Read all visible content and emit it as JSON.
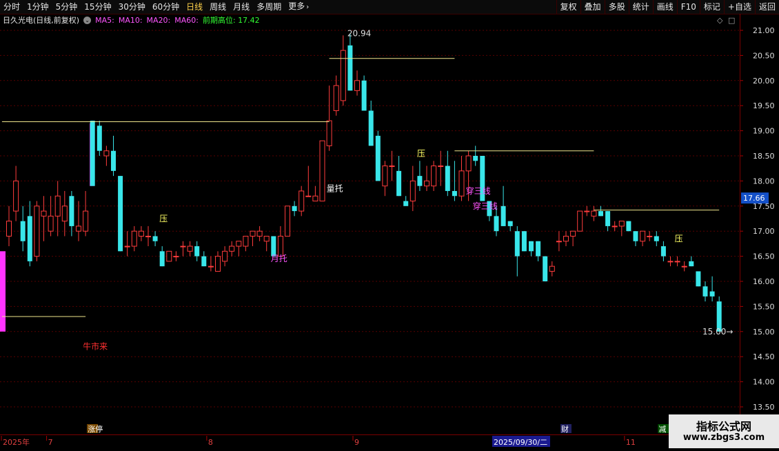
{
  "toolbar": {
    "tabs": [
      {
        "label": "分时",
        "active": false
      },
      {
        "label": "1分钟",
        "active": false
      },
      {
        "label": "5分钟",
        "active": false
      },
      {
        "label": "15分钟",
        "active": false
      },
      {
        "label": "30分钟",
        "active": false
      },
      {
        "label": "60分钟",
        "active": false
      },
      {
        "label": "日线",
        "active": true
      },
      {
        "label": "周线",
        "active": false
      },
      {
        "label": "月线",
        "active": false
      },
      {
        "label": "多周期",
        "active": false
      },
      {
        "label": "更多",
        "active": false
      }
    ],
    "more_chevron": "›",
    "right_buttons": [
      "复权",
      "叠加",
      "多股",
      "统计",
      "画线",
      "F10",
      "标记",
      "+自选",
      "返回"
    ]
  },
  "infobar": {
    "stock": "日久光电(日线,前复权)",
    "toggle_glyph": "⌄",
    "ma5": "MA5:",
    "ma10": "MA10:",
    "ma20": "MA20:",
    "ma60": "MA60:",
    "prev_high": "前期高位: 17.42",
    "icon_diamond": "◇",
    "icon_restore": "□"
  },
  "colors": {
    "up": "#ff3c3c",
    "down": "#39e6ea",
    "signal": "#ff33ff",
    "hline": "#f0e68c",
    "grid": "#5a0000",
    "ma5": "#ff55ff",
    "ma_other": "#ff55ff",
    "prev_high": "#33ff33"
  },
  "chart_data": {
    "type": "candlestick",
    "ylim": [
      13.25,
      21.15
    ],
    "y_ticks": [
      "21.00",
      "20.50",
      "20.00",
      "19.50",
      "19.00",
      "18.50",
      "18.00",
      "17.50",
      "17.00",
      "16.50",
      "16.00",
      "15.50",
      "15.00",
      "14.50",
      "14.00",
      "13.50"
    ],
    "last_price": "17.66",
    "candles": [
      {
        "o": 16.9,
        "h": 17.5,
        "l": 16.7,
        "c": 17.2
      },
      {
        "o": 17.4,
        "h": 18.3,
        "l": 17.2,
        "c": 18.0
      },
      {
        "o": 17.2,
        "h": 17.5,
        "l": 16.6,
        "c": 16.8
      },
      {
        "o": 17.3,
        "h": 17.6,
        "l": 16.3,
        "c": 16.4
      },
      {
        "o": 16.5,
        "h": 17.6,
        "l": 16.4,
        "c": 17.5
      },
      {
        "o": 17.3,
        "h": 17.7,
        "l": 16.8,
        "c": 17.4
      },
      {
        "o": 17.0,
        "h": 17.7,
        "l": 16.9,
        "c": 17.3
      },
      {
        "o": 17.3,
        "h": 18.0,
        "l": 16.9,
        "c": 17.7
      },
      {
        "o": 17.2,
        "h": 17.8,
        "l": 16.9,
        "c": 17.5
      },
      {
        "o": 17.7,
        "h": 17.8,
        "l": 16.9,
        "c": 17.1
      },
      {
        "o": 17.0,
        "h": 17.6,
        "l": 16.8,
        "c": 17.1
      },
      {
        "o": 17.0,
        "h": 17.8,
        "l": 16.9,
        "c": 17.4
      },
      {
        "o": 19.2,
        "h": 19.2,
        "l": 18.0,
        "c": 17.9
      },
      {
        "o": 19.1,
        "h": 19.2,
        "l": 18.5,
        "c": 18.6
      },
      {
        "o": 18.5,
        "h": 18.7,
        "l": 18.3,
        "c": 18.6
      },
      {
        "o": 18.6,
        "h": 18.9,
        "l": 18.1,
        "c": 18.2
      },
      {
        "o": 18.1,
        "h": 18.1,
        "l": 16.6,
        "c": 16.6
      },
      {
        "o": 16.7,
        "h": 17.0,
        "l": 16.5,
        "c": 16.7
      },
      {
        "o": 16.7,
        "h": 17.1,
        "l": 16.6,
        "c": 17.0
      },
      {
        "o": 16.9,
        "h": 17.1,
        "l": 16.8,
        "c": 17.0
      },
      {
        "o": 16.9,
        "h": 17.1,
        "l": 16.7,
        "c": 16.9
      },
      {
        "o": 16.9,
        "h": 17.0,
        "l": 16.7,
        "c": 16.8
      },
      {
        "o": 16.6,
        "h": 16.7,
        "l": 16.3,
        "c": 16.3
      },
      {
        "o": 16.4,
        "h": 16.6,
        "l": 16.4,
        "c": 16.6
      },
      {
        "o": 16.5,
        "h": 16.6,
        "l": 16.4,
        "c": 16.5
      },
      {
        "o": 16.7,
        "h": 16.8,
        "l": 16.5,
        "c": 16.7
      },
      {
        "o": 16.6,
        "h": 16.8,
        "l": 16.5,
        "c": 16.7
      },
      {
        "o": 16.7,
        "h": 16.8,
        "l": 16.4,
        "c": 16.5
      },
      {
        "o": 16.5,
        "h": 16.6,
        "l": 16.3,
        "c": 16.3
      },
      {
        "o": 16.3,
        "h": 16.5,
        "l": 16.2,
        "c": 16.3
      },
      {
        "o": 16.2,
        "h": 16.6,
        "l": 16.2,
        "c": 16.5
      },
      {
        "o": 16.4,
        "h": 16.7,
        "l": 16.3,
        "c": 16.6
      },
      {
        "o": 16.6,
        "h": 16.8,
        "l": 16.5,
        "c": 16.7
      },
      {
        "o": 16.7,
        "h": 16.8,
        "l": 16.5,
        "c": 16.8
      },
      {
        "o": 16.7,
        "h": 16.9,
        "l": 16.6,
        "c": 16.9
      },
      {
        "o": 16.9,
        "h": 17.0,
        "l": 16.7,
        "c": 17.0
      },
      {
        "o": 16.9,
        "h": 17.1,
        "l": 16.8,
        "c": 17.0
      },
      {
        "o": 16.8,
        "h": 16.9,
        "l": 16.6,
        "c": 16.9
      },
      {
        "o": 16.9,
        "h": 16.9,
        "l": 16.5,
        "c": 16.5
      },
      {
        "o": 16.5,
        "h": 17.1,
        "l": 16.5,
        "c": 16.9
      },
      {
        "o": 16.9,
        "h": 17.5,
        "l": 16.9,
        "c": 17.5
      },
      {
        "o": 17.5,
        "h": 17.6,
        "l": 17.3,
        "c": 17.4
      },
      {
        "o": 17.4,
        "h": 17.9,
        "l": 17.3,
        "c": 17.8
      },
      {
        "o": 17.7,
        "h": 18.3,
        "l": 17.7,
        "c": 17.7
      },
      {
        "o": 17.6,
        "h": 17.9,
        "l": 17.6,
        "c": 17.7
      },
      {
        "o": 17.6,
        "h": 18.8,
        "l": 17.6,
        "c": 18.8
      },
      {
        "o": 18.7,
        "h": 19.9,
        "l": 18.6,
        "c": 19.2
      },
      {
        "o": 19.4,
        "h": 20.1,
        "l": 19.3,
        "c": 19.9
      },
      {
        "o": 19.6,
        "h": 20.9,
        "l": 19.5,
        "c": 20.6
      },
      {
        "o": 20.7,
        "h": 20.94,
        "l": 19.8,
        "c": 19.8
      },
      {
        "o": 19.8,
        "h": 20.2,
        "l": 19.7,
        "c": 20.0
      },
      {
        "o": 20.0,
        "h": 20.1,
        "l": 19.4,
        "c": 19.4
      },
      {
        "o": 19.4,
        "h": 19.6,
        "l": 18.7,
        "c": 18.7
      },
      {
        "o": 18.9,
        "h": 19.0,
        "l": 18.0,
        "c": 18.0
      },
      {
        "o": 17.9,
        "h": 18.4,
        "l": 17.7,
        "c": 18.3
      },
      {
        "o": 18.3,
        "h": 18.6,
        "l": 18.0,
        "c": 18.3
      },
      {
        "o": 18.2,
        "h": 18.5,
        "l": 17.7,
        "c": 17.7
      },
      {
        "o": 17.6,
        "h": 17.7,
        "l": 17.5,
        "c": 17.5
      },
      {
        "o": 17.6,
        "h": 18.3,
        "l": 17.4,
        "c": 18.0
      },
      {
        "o": 18.1,
        "h": 18.4,
        "l": 17.8,
        "c": 17.9
      },
      {
        "o": 17.9,
        "h": 18.3,
        "l": 17.8,
        "c": 18.0
      },
      {
        "o": 17.9,
        "h": 18.4,
        "l": 17.8,
        "c": 18.3
      },
      {
        "o": 18.3,
        "h": 18.6,
        "l": 17.9,
        "c": 18.3
      },
      {
        "o": 18.3,
        "h": 18.6,
        "l": 17.7,
        "c": 17.8
      },
      {
        "o": 17.8,
        "h": 18.4,
        "l": 17.6,
        "c": 17.7
      },
      {
        "o": 17.7,
        "h": 18.5,
        "l": 17.6,
        "c": 18.2
      },
      {
        "o": 18.2,
        "h": 18.6,
        "l": 17.6,
        "c": 18.5
      },
      {
        "o": 18.5,
        "h": 18.7,
        "l": 18.3,
        "c": 18.4
      },
      {
        "o": 18.5,
        "h": 18.5,
        "l": 17.6,
        "c": 17.6
      },
      {
        "o": 17.6,
        "h": 17.6,
        "l": 17.2,
        "c": 17.3
      },
      {
        "o": 17.3,
        "h": 17.5,
        "l": 16.9,
        "c": 17.0
      },
      {
        "o": 17.5,
        "h": 17.9,
        "l": 17.1,
        "c": 17.1
      },
      {
        "o": 17.2,
        "h": 17.2,
        "l": 17.0,
        "c": 17.1
      },
      {
        "o": 17.0,
        "h": 17.1,
        "l": 16.1,
        "c": 16.5
      },
      {
        "o": 17.0,
        "h": 17.0,
        "l": 16.6,
        "c": 16.6
      },
      {
        "o": 16.8,
        "h": 16.8,
        "l": 16.5,
        "c": 16.6
      },
      {
        "o": 16.8,
        "h": 16.8,
        "l": 16.4,
        "c": 16.5
      },
      {
        "o": 16.5,
        "h": 16.5,
        "l": 16.0,
        "c": 16.0
      },
      {
        "o": 16.2,
        "h": 16.4,
        "l": 16.1,
        "c": 16.3
      },
      {
        "o": 16.8,
        "h": 17.0,
        "l": 16.6,
        "c": 16.8
      },
      {
        "o": 16.8,
        "h": 17.0,
        "l": 16.7,
        "c": 16.9
      },
      {
        "o": 16.9,
        "h": 17.0,
        "l": 16.7,
        "c": 17.0
      },
      {
        "o": 17.0,
        "h": 17.4,
        "l": 17.0,
        "c": 17.4
      },
      {
        "o": 17.4,
        "h": 17.5,
        "l": 17.3,
        "c": 17.4
      },
      {
        "o": 17.3,
        "h": 17.5,
        "l": 17.2,
        "c": 17.4
      },
      {
        "o": 17.4,
        "h": 17.5,
        "l": 17.3,
        "c": 17.3
      },
      {
        "o": 17.4,
        "h": 17.4,
        "l": 17.0,
        "c": 17.1
      },
      {
        "o": 17.1,
        "h": 17.2,
        "l": 17.0,
        "c": 17.1
      },
      {
        "o": 17.1,
        "h": 17.2,
        "l": 16.9,
        "c": 17.2
      },
      {
        "o": 17.2,
        "h": 17.2,
        "l": 17.0,
        "c": 17.0
      },
      {
        "o": 17.0,
        "h": 17.0,
        "l": 16.7,
        "c": 16.8
      },
      {
        "o": 16.8,
        "h": 17.0,
        "l": 16.7,
        "c": 17.0
      },
      {
        "o": 16.9,
        "h": 17.0,
        "l": 16.8,
        "c": 16.9
      },
      {
        "o": 16.9,
        "h": 17.0,
        "l": 16.7,
        "c": 16.8
      },
      {
        "o": 16.7,
        "h": 16.8,
        "l": 16.4,
        "c": 16.5
      },
      {
        "o": 16.4,
        "h": 16.5,
        "l": 16.3,
        "c": 16.4
      },
      {
        "o": 16.4,
        "h": 16.5,
        "l": 16.3,
        "c": 16.4
      },
      {
        "o": 16.3,
        "h": 16.4,
        "l": 16.2,
        "c": 16.3
      },
      {
        "o": 16.4,
        "h": 16.5,
        "l": 16.3,
        "c": 16.3
      },
      {
        "o": 16.2,
        "h": 16.2,
        "l": 15.9,
        "c": 15.9
      },
      {
        "o": 15.9,
        "h": 16.0,
        "l": 15.6,
        "c": 15.7
      },
      {
        "o": 15.8,
        "h": 16.1,
        "l": 15.6,
        "c": 15.7
      },
      {
        "o": 15.6,
        "h": 15.7,
        "l": 15.0,
        "c": 15.0
      }
    ],
    "signal_bars": [
      {
        "index": 12,
        "top": 19.15,
        "bottom": 17.9
      },
      {
        "index": 0,
        "top": 16.6,
        "bottom": 15.0
      }
    ],
    "hlines": [
      {
        "y": 19.18,
        "x1": -1,
        "x2": 46
      },
      {
        "y": 20.44,
        "x1": 46,
        "x2": 64
      },
      {
        "y": 18.6,
        "x1": 64,
        "x2": 84
      },
      {
        "y": 17.42,
        "x1": 84,
        "x2": 102
      },
      {
        "y": 15.3,
        "x1": -1,
        "x2": 11
      }
    ],
    "annotations": [
      {
        "text": "20.94",
        "price": 20.94,
        "index": 49,
        "color": "#dddddd"
      },
      {
        "text": "15.00→",
        "price": 15.0,
        "index": 100,
        "color": "#dddddd"
      },
      {
        "text": "压",
        "price": 17.25,
        "index": 22,
        "color": "#ffff66"
      },
      {
        "text": "压",
        "price": 18.55,
        "index": 59,
        "color": "#ffff66"
      },
      {
        "text": "压",
        "price": 16.85,
        "index": 96,
        "color": "#ffff66"
      },
      {
        "text": "量托",
        "price": 17.85,
        "index": 46,
        "color": "#ffffff"
      },
      {
        "text": "月托",
        "price": 16.45,
        "index": 38,
        "color": "#ff55ff"
      },
      {
        "text": "穿三线",
        "price": 17.8,
        "index": 66,
        "color": "#ff55ff"
      },
      {
        "text": "穿三线",
        "price": 17.5,
        "index": 67,
        "color": "#ff55ff"
      },
      {
        "text": "牛市来",
        "price": 14.7,
        "index": 11,
        "color": "#ff3030"
      }
    ],
    "event_markers": [
      {
        "text": "涨停",
        "index": 12,
        "color": "#ffffff",
        "bg": "#7a4a00"
      },
      {
        "text": "财",
        "index": 80,
        "color": "#ffffff",
        "bg": "#202060"
      },
      {
        "text": "减",
        "index": 94,
        "color": "#ffffff",
        "bg": "#005000"
      }
    ],
    "x_labels": [
      {
        "text": "2025年",
        "index": 0
      },
      {
        "text": "7",
        "index": 6
      },
      {
        "text": "8",
        "index": 29
      },
      {
        "text": "9",
        "index": 50
      },
      {
        "text": "2025/09/30/二",
        "index": 70,
        "highlight": true
      },
      {
        "text": "11",
        "index": 89
      }
    ]
  },
  "watermark": {
    "line1": "指标公式网",
    "line2": "www.zbgs3.com"
  }
}
